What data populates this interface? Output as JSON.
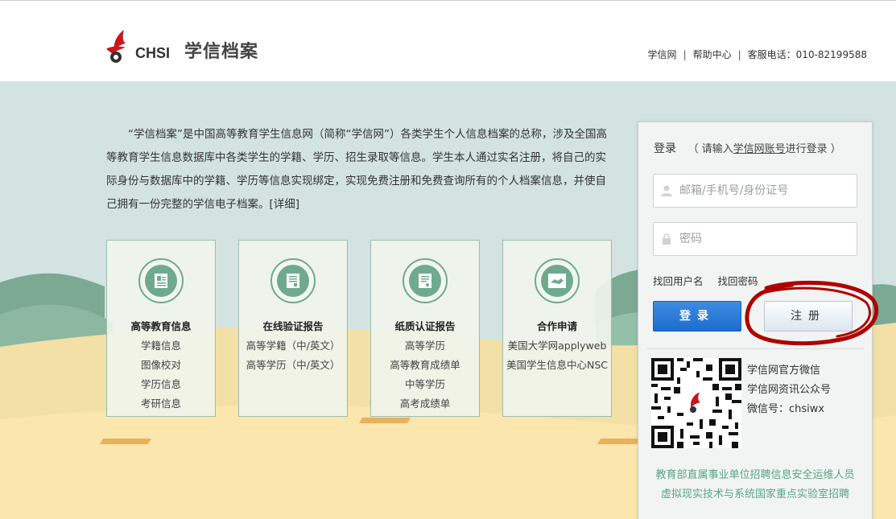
{
  "header": {
    "logo_text": "CHSI",
    "site_title": "学信档案",
    "links": [
      "学信网",
      "帮助中心"
    ],
    "phone_label": "客服电话：010-82199588"
  },
  "intro": {
    "text": "“学信档案”是中国高等教育学生信息网（简称“学信网”）各类学生个人信息档案的总称，涉及全国高等教育学生信息数据库中各类学生的学籍、学历、招生录取等信息。学生本人通过实名注册，将自己的实际身份与数据库中的学籍、学历等信息实现绑定，实现免费注册和免费查询所有的个人档案信息，并使自己拥有一份完整的学信电子档案。",
    "detail_link": "[详细]"
  },
  "cards": [
    {
      "title": "高等教育信息",
      "icon": "student-record-icon",
      "items": [
        "学籍信息",
        "图像校对",
        "学历信息",
        "考研信息"
      ]
    },
    {
      "title": "在线验证报告",
      "icon": "verification-report-icon",
      "items": [
        "高等学籍（中/英文）",
        "高等学历（中/英文）"
      ]
    },
    {
      "title": "纸质认证报告",
      "icon": "paper-certificate-icon",
      "items": [
        "高等学历",
        "高等教育成绩单",
        "中等学历",
        "高考成绩单"
      ]
    },
    {
      "title": "合作申请",
      "icon": "handshake-icon",
      "items": [
        "美国大学网applyweb",
        "美国学生信息中心NSC"
      ]
    }
  ],
  "login": {
    "title": "登录",
    "hint_prefix": "（ 请输入",
    "hint_link": "学信网账号",
    "hint_suffix": "进行登录 ）",
    "username_placeholder": "邮箱/手机号/身份证号",
    "password_placeholder": "密码",
    "forgot_username": "找回用户名",
    "forgot_password": "找回密码",
    "login_button": "登录",
    "register_button": "注册",
    "wechat_lines": [
      "学信网官方微信",
      "学信网资讯公众号",
      "微信号：chsiwx"
    ],
    "notices": [
      "教育部直属事业单位招聘信息安全运维人员",
      "虚拟现实技术与系统国家重点实验室招聘"
    ]
  },
  "colors": {
    "banner_bg": "#d3e3e1",
    "accent_green": "#6faa8f",
    "login_blue": "#1d6ccf",
    "annotation_red": "#b00000"
  }
}
